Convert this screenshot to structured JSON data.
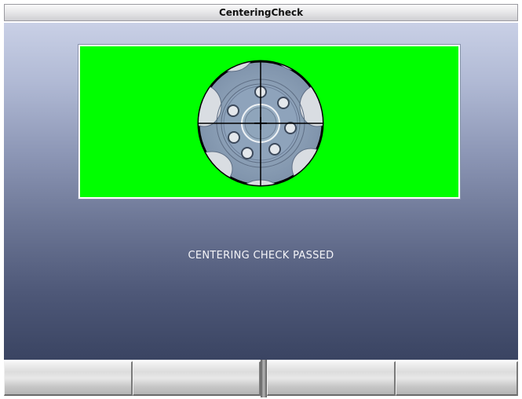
{
  "window": {
    "title": "CenteringCheck"
  },
  "target": {
    "background_color": "#00ff00",
    "wheel_icon": "wheel-crosshair-icon"
  },
  "status": {
    "message": "CENTERING CHECK PASSED"
  },
  "function_keys": [
    {
      "label": ""
    },
    {
      "label": ""
    },
    {
      "label": ""
    },
    {
      "label": ""
    }
  ]
}
